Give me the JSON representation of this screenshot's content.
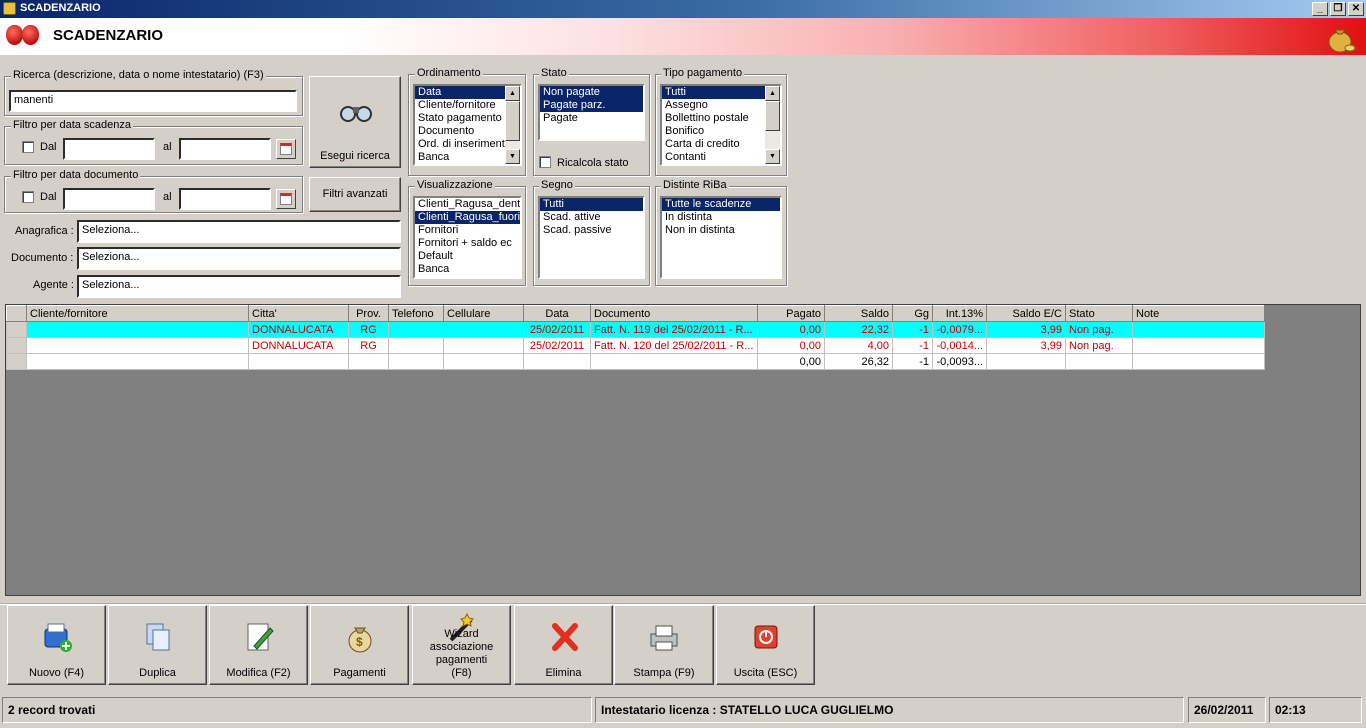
{
  "window": {
    "title": "SCADENZARIO",
    "min_label": "_",
    "restore_label": "❐",
    "close_label": "✕"
  },
  "banner": {
    "title": "SCADENZARIO"
  },
  "search": {
    "legend": "Ricerca (descrizione, data o nome intestatario) (F3)",
    "value": "manenti"
  },
  "filter_due": {
    "legend": "Filtro per data scadenza",
    "from_label": "Dal",
    "to_label": "al",
    "from_value": "",
    "to_value": ""
  },
  "filter_doc": {
    "legend": "Filtro per data documento",
    "from_label": "Dal",
    "to_label": "al",
    "from_value": "",
    "to_value": ""
  },
  "buttons": {
    "search": "Esegui ricerca",
    "advanced": "Filtri avanzati"
  },
  "selectors": {
    "anagrafica": {
      "label": "Anagrafica :",
      "value": "Seleziona..."
    },
    "documento": {
      "label": "Documento :",
      "value": "Seleziona..."
    },
    "agente": {
      "label": "Agente :",
      "value": "Seleziona..."
    }
  },
  "ordinamento": {
    "legend": "Ordinamento",
    "items": [
      "Data",
      "Cliente/fornitore",
      "Stato pagamento",
      "Documento",
      "Ord. di inserimento",
      "Banca"
    ],
    "selected": [
      0
    ]
  },
  "stato": {
    "legend": "Stato",
    "items": [
      "Non pagate",
      "Pagate parz.",
      "Pagate"
    ],
    "selected": [
      0,
      1
    ],
    "recalc_label": "Ricalcola stato"
  },
  "tipo_pagamento": {
    "legend": "Tipo pagamento",
    "items": [
      "Tutti",
      "Assegno",
      "Bollettino postale",
      "Bonifico",
      "Carta di credito",
      "Contanti"
    ],
    "selected": [
      0
    ]
  },
  "visualizzazione": {
    "legend": "Visualizzazione",
    "items": [
      "Clienti_Ragusa_dentro",
      "Clienti_Ragusa_fuori",
      "Fornitori",
      "Fornitori + saldo ec",
      "Default",
      "Banca"
    ],
    "selected": [
      1
    ]
  },
  "segno": {
    "legend": "Segno",
    "items": [
      "Tutti",
      "Scad. attive",
      "Scad. passive"
    ],
    "selected": [
      0
    ]
  },
  "distinte": {
    "legend": "Distinte RiBa",
    "items": [
      "Tutte le scadenze",
      "In distinta",
      "Non in distinta"
    ],
    "selected": [
      0
    ]
  },
  "grid": {
    "headers": [
      "Cliente/fornitore",
      "Citta'",
      "Prov.",
      "Telefono",
      "Cellulare",
      "Data",
      "Documento",
      "Pagato",
      "Saldo",
      "Gg",
      "Int.13%",
      "Saldo E/C",
      "Stato",
      "Note"
    ],
    "rows": [
      [
        "",
        "DONNALUCATA",
        "RG",
        "",
        "",
        "25/02/2011",
        "Fatt. N. 119 del 25/02/2011 - R...",
        "0,00",
        "22,32",
        "-1",
        "-0,0079...",
        "3,99",
        "Non pag.",
        ""
      ],
      [
        "",
        "DONNALUCATA",
        "RG",
        "",
        "",
        "25/02/2011",
        "Fatt. N. 120 del 25/02/2011 - R...",
        "0,00",
        "4,00",
        "-1",
        "-0,0014...",
        "3,99",
        "Non pag.",
        ""
      ]
    ],
    "totals": [
      "",
      "",
      "",
      "",
      "",
      "",
      "",
      "0,00",
      "26,32",
      "-1",
      "-0,0093...",
      "",
      "",
      ""
    ]
  },
  "toolbar": [
    {
      "label": "Nuovo (F4)",
      "icon": "new-icon"
    },
    {
      "label": "Duplica",
      "icon": "duplicate-icon"
    },
    {
      "label": "Modifica (F2)",
      "icon": "edit-icon"
    },
    {
      "label": "Pagamenti",
      "icon": "money-bag-icon"
    },
    {
      "label": "Wizard associazione pagamenti (F8)",
      "icon": "wizard-icon"
    },
    {
      "label": "Elimina",
      "icon": "delete-icon"
    },
    {
      "label": "Stampa (F9)",
      "icon": "printer-icon"
    },
    {
      "label": "Uscita (ESC)",
      "icon": "exit-icon"
    }
  ],
  "status": {
    "records": "2 record trovati",
    "license": "Intestatario licenza : STATELLO LUCA GUGLIELMO",
    "date": "26/02/2011",
    "time": "02:13"
  },
  "colors": {
    "selection": "#0a246a",
    "row_highlight": "#00ffff",
    "red_text": "#c00000"
  }
}
